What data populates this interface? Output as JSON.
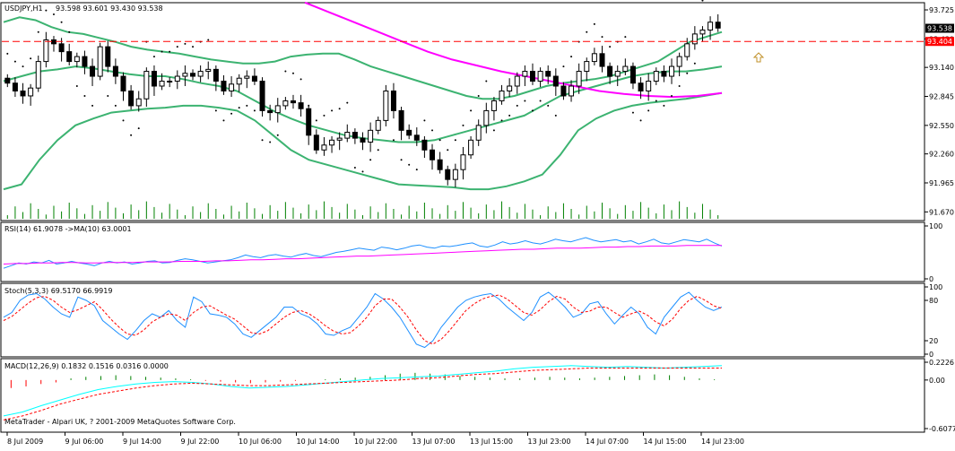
{
  "chart_data": [
    {
      "type": "candlestick",
      "title": "USDJPY,H1",
      "ohlc_header": "93.598 93.601 93.430 93.538",
      "symbol": "USDJPY",
      "timeframe": "H1",
      "last_price": {
        "open": 93.598,
        "high": 93.601,
        "low": 93.43,
        "close": 93.538
      },
      "bid_tag": "93.538",
      "ask_tag": "93.404",
      "ylim": [
        91.6,
        93.78
      ],
      "y_ticks": [
        "93.725",
        "93.430",
        "93.140",
        "92.845",
        "92.550",
        "92.260",
        "91.965",
        "91.670"
      ],
      "x_ticks": [
        "8 Jul 2009",
        "9 Jul 06:00",
        "9 Jul 14:00",
        "9 Jul 22:00",
        "10 Jul 06:00",
        "10 Jul 14:00",
        "10 Jul 22:00",
        "13 Jul 07:00",
        "13 Jul 15:00",
        "13 Jul 23:00",
        "14 Jul 07:00",
        "14 Jul 15:00",
        "14 Jul 23:00"
      ],
      "candles_close": [
        92.98,
        92.9,
        92.85,
        92.93,
        93.2,
        93.42,
        93.38,
        93.3,
        93.2,
        93.25,
        93.15,
        93.05,
        93.35,
        93.15,
        93.05,
        92.9,
        92.75,
        92.82,
        93.1,
        92.95,
        93.0,
        93.0,
        93.05,
        93.08,
        93.05,
        93.1,
        93.12,
        93.0,
        92.9,
        92.97,
        93.03,
        93.05,
        93.0,
        92.7,
        92.68,
        92.75,
        92.8,
        92.78,
        92.72,
        92.45,
        92.3,
        92.35,
        92.4,
        92.42,
        92.48,
        92.42,
        92.38,
        92.5,
        92.6,
        92.9,
        92.7,
        92.5,
        92.45,
        92.4,
        92.3,
        92.2,
        92.1,
        92.0,
        92.1,
        92.25,
        92.4,
        92.55,
        92.7,
        92.8,
        92.9,
        92.95,
        93.05,
        93.1,
        93.0,
        93.1,
        93.05,
        92.95,
        92.85,
        92.95,
        93.1,
        93.2,
        93.28,
        93.15,
        93.05,
        93.1,
        93.15,
        92.98,
        92.9,
        93.0,
        93.1,
        93.05,
        93.15,
        93.25,
        93.38,
        93.48,
        93.52,
        93.6,
        93.54
      ],
      "bollinger_upper": [
        93.6,
        93.65,
        93.62,
        93.55,
        93.5,
        93.48,
        93.44,
        93.4,
        93.35,
        93.32,
        93.3,
        93.28,
        93.25,
        93.22,
        93.2,
        93.18,
        93.18,
        93.2,
        93.25,
        93.27,
        93.28,
        93.28,
        93.22,
        93.15,
        93.1,
        93.05,
        93.0,
        92.95,
        92.9,
        92.85,
        92.82,
        92.82,
        92.85,
        92.9,
        92.95,
        92.98,
        93.0,
        93.02,
        93.05,
        93.1,
        93.15,
        93.2,
        93.3,
        93.4,
        93.45,
        93.5
      ],
      "bollinger_middle": [
        93.0,
        93.05,
        93.1,
        93.12,
        93.15,
        93.13,
        93.1,
        93.07,
        93.05,
        93.05,
        93.02,
        92.98,
        92.95,
        92.9,
        92.8,
        92.7,
        92.62,
        92.55,
        92.5,
        92.45,
        92.42,
        92.4,
        92.38,
        92.38,
        92.4,
        92.45,
        92.5,
        92.55,
        92.6,
        92.65,
        92.75,
        92.85,
        92.9,
        92.95,
        93.0,
        93.05,
        93.08,
        93.1,
        93.1,
        93.12,
        93.15
      ],
      "bollinger_lower": [
        91.9,
        91.95,
        92.2,
        92.4,
        92.55,
        92.62,
        92.68,
        92.7,
        92.72,
        92.73,
        92.75,
        92.75,
        92.73,
        92.7,
        92.6,
        92.45,
        92.3,
        92.2,
        92.15,
        92.1,
        92.05,
        92.0,
        91.95,
        91.94,
        91.93,
        91.92,
        91.9,
        91.9,
        91.93,
        91.98,
        92.05,
        92.25,
        92.5,
        92.62,
        92.7,
        92.75,
        92.78,
        92.8,
        92.82,
        92.85,
        92.88
      ],
      "moving_average": [
        93.8,
        93.7,
        93.6,
        93.5,
        93.4,
        93.3,
        93.22,
        93.16,
        93.1,
        93.05,
        93.0,
        92.95,
        92.9,
        92.87,
        92.85,
        92.84,
        92.85,
        92.88
      ]
    },
    {
      "type": "line",
      "title": "RSI(14) 61.9078  ->MA(10) 63.0001",
      "y_ticks": [
        "100",
        "0"
      ],
      "ylim": [
        0,
        100
      ],
      "series": [
        {
          "name": "RSI(14)",
          "color": "#1e90ff",
          "values": [
            20,
            25,
            30,
            28,
            32,
            30,
            35,
            28,
            30,
            33,
            30,
            28,
            25,
            30,
            33,
            30,
            32,
            28,
            30,
            33,
            34,
            30,
            31,
            35,
            38,
            36,
            33,
            30,
            32,
            34,
            36,
            40,
            45,
            42,
            40,
            44,
            46,
            43,
            41,
            45,
            48,
            44,
            42,
            46,
            50,
            52,
            55,
            58,
            56,
            54,
            60,
            58,
            55,
            58,
            62,
            64,
            60,
            58,
            62,
            61,
            63,
            66,
            68,
            62,
            60,
            64,
            70,
            66,
            68,
            72,
            68,
            66,
            70,
            75,
            72,
            70,
            74,
            78,
            73,
            70,
            72,
            74,
            70,
            72,
            66,
            70,
            75,
            68,
            66,
            70,
            74,
            72,
            70,
            75,
            68,
            62
          ]
        },
        {
          "name": "MA(10)",
          "color": "#ff00ff",
          "values": [
            28,
            29,
            29,
            30,
            30,
            31,
            31,
            30,
            30,
            31,
            31,
            31,
            32,
            32,
            32,
            33,
            33,
            33,
            34,
            34,
            35,
            36,
            36,
            37,
            38,
            38,
            39,
            40,
            41,
            42,
            43,
            43,
            44,
            45,
            46,
            47,
            48,
            49,
            50,
            51,
            52,
            53,
            54,
            55,
            56,
            56,
            57,
            58,
            58,
            58,
            59,
            60,
            60,
            61,
            61,
            62,
            62,
            62,
            63,
            63,
            63,
            63
          ]
        }
      ]
    },
    {
      "type": "line",
      "title": "Stoch(5,3,3) 69.5170 66.9919",
      "y_ticks": [
        "100",
        "80",
        "20",
        "0"
      ],
      "ylim": [
        0,
        100
      ],
      "series": [
        {
          "name": "Main",
          "color": "#1e90ff",
          "values": [
            55,
            62,
            80,
            88,
            90,
            82,
            70,
            60,
            55,
            85,
            80,
            72,
            50,
            40,
            30,
            22,
            35,
            50,
            60,
            55,
            65,
            50,
            40,
            85,
            78,
            60,
            58,
            55,
            45,
            30,
            25,
            35,
            45,
            55,
            70,
            70,
            60,
            55,
            45,
            30,
            28,
            35,
            40,
            55,
            70,
            90,
            82,
            70,
            55,
            35,
            15,
            10,
            20,
            40,
            55,
            70,
            80,
            85,
            88,
            90,
            82,
            70,
            60,
            50,
            62,
            85,
            92,
            82,
            70,
            55,
            60,
            75,
            78,
            60,
            45,
            58,
            70,
            60,
            40,
            30,
            55,
            70,
            85,
            92,
            80,
            70,
            65,
            70
          ]
        },
        {
          "name": "Signal",
          "color": "#ff0000",
          "values": [
            50,
            56,
            66,
            76,
            84,
            86,
            80,
            70,
            62,
            66,
            72,
            78,
            66,
            52,
            40,
            30,
            28,
            36,
            48,
            55,
            60,
            58,
            50,
            62,
            70,
            72,
            65,
            58,
            52,
            42,
            32,
            30,
            35,
            45,
            55,
            62,
            65,
            60,
            52,
            42,
            34,
            30,
            32,
            42,
            55,
            72,
            82,
            82,
            70,
            55,
            36,
            20,
            15,
            22,
            35,
            50,
            65,
            75,
            82,
            86,
            88,
            82,
            72,
            62,
            58,
            66,
            78,
            86,
            82,
            70,
            62,
            64,
            70,
            70,
            62,
            55,
            60,
            64,
            58,
            48,
            42,
            52,
            68,
            80,
            86,
            80,
            72,
            68
          ]
        }
      ]
    },
    {
      "type": "bar",
      "title": "MACD(12,26,9) 0.1832 0.1516 0.0316 0.0000",
      "y_ticks": [
        "0.2226",
        "0.00",
        "-0.6077"
      ],
      "ylim": [
        -0.6077,
        0.2226
      ],
      "series": [
        {
          "name": "Histogram",
          "color": "#008000",
          "values": [
            -0.1,
            -0.08,
            -0.05,
            -0.03,
            0.02,
            0.04,
            0.05,
            0.06,
            0.05,
            0.04,
            0.03,
            0.02,
            0.01,
            -0.01,
            -0.02,
            -0.03,
            -0.04,
            -0.03,
            -0.02,
            -0.01,
            0.0,
            0.01,
            0.02,
            0.03,
            0.04,
            0.06,
            0.08,
            0.09,
            0.08,
            0.07,
            0.05,
            0.04,
            0.03,
            0.02,
            0.02,
            0.03,
            0.04,
            0.03,
            0.02,
            0.03,
            0.04,
            0.05,
            0.06,
            0.07,
            0.06,
            0.04,
            0.02,
            0.01
          ]
        },
        {
          "name": "MACD",
          "color": "#00ffff",
          "values": [
            -0.45,
            -0.4,
            -0.32,
            -0.25,
            -0.18,
            -0.12,
            -0.08,
            -0.05,
            -0.03,
            -0.02,
            -0.03,
            -0.05,
            -0.08,
            -0.1,
            -0.09,
            -0.08,
            -0.06,
            -0.04,
            -0.02,
            0.0,
            0.02,
            0.03,
            0.04,
            0.05,
            0.07,
            0.09,
            0.11,
            0.14,
            0.16,
            0.17,
            0.18,
            0.17,
            0.16,
            0.17,
            0.16,
            0.15,
            0.16,
            0.17,
            0.18
          ]
        },
        {
          "name": "Signal",
          "color": "#ff0000",
          "values": [
            -0.5,
            -0.45,
            -0.38,
            -0.3,
            -0.24,
            -0.18,
            -0.14,
            -0.1,
            -0.07,
            -0.05,
            -0.04,
            -0.05,
            -0.06,
            -0.07,
            -0.07,
            -0.06,
            -0.05,
            -0.04,
            -0.03,
            -0.02,
            -0.01,
            0.0,
            0.02,
            0.03,
            0.05,
            0.07,
            0.08,
            0.1,
            0.12,
            0.13,
            0.14,
            0.15,
            0.15,
            0.15,
            0.15,
            0.15,
            0.15,
            0.15,
            0.15
          ]
        }
      ]
    }
  ],
  "footer_text": "MetaTrader - Alpari UK, ? 2001-2009 MetaQuotes Software Corp.",
  "colors": {
    "bull_candle": "#ffffff",
    "bear_candle": "#000000",
    "bollinger": "#3cb371",
    "moving_average": "#ff00ff",
    "parabolic_sar": "#000000",
    "volume": "#008000",
    "ask_line": "#ff0000",
    "grid": "#c0c0c0"
  }
}
